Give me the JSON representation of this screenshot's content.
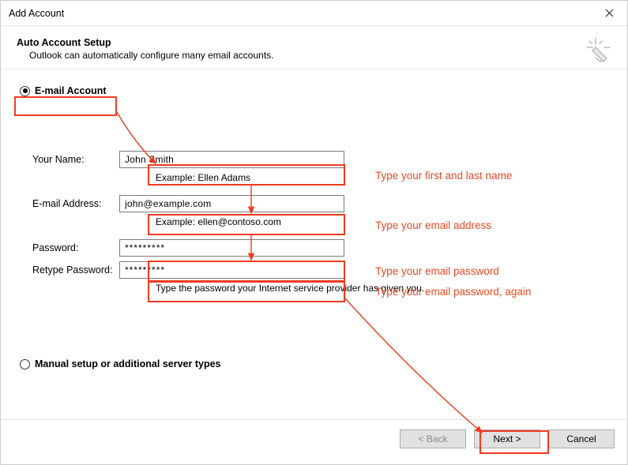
{
  "window": {
    "title": "Add Account"
  },
  "header": {
    "title": "Auto Account Setup",
    "subtitle": "Outlook can automatically configure many email accounts."
  },
  "radios": {
    "email_label": "E-mail Account",
    "manual_label": "Manual setup or additional server types"
  },
  "form": {
    "name_label": "Your Name:",
    "name_value": "John Smith",
    "name_example": "Example: Ellen Adams",
    "email_label": "E-mail Address:",
    "email_value": "john@example.com",
    "email_example": "Example: ellen@contoso.com",
    "password_label": "Password:",
    "password_value": "*********",
    "retype_label": "Retype Password:",
    "retype_value": "*********",
    "password_hint": "Type the password your Internet service provider has given you."
  },
  "annotations": {
    "name": "Type your first and last name",
    "email": "Type your email address",
    "password": "Type your email password",
    "retype": "Type your email password, again"
  },
  "buttons": {
    "back": "< Back",
    "next": "Next >",
    "cancel": "Cancel"
  },
  "colors": {
    "annotation": "#ef3b1f"
  }
}
